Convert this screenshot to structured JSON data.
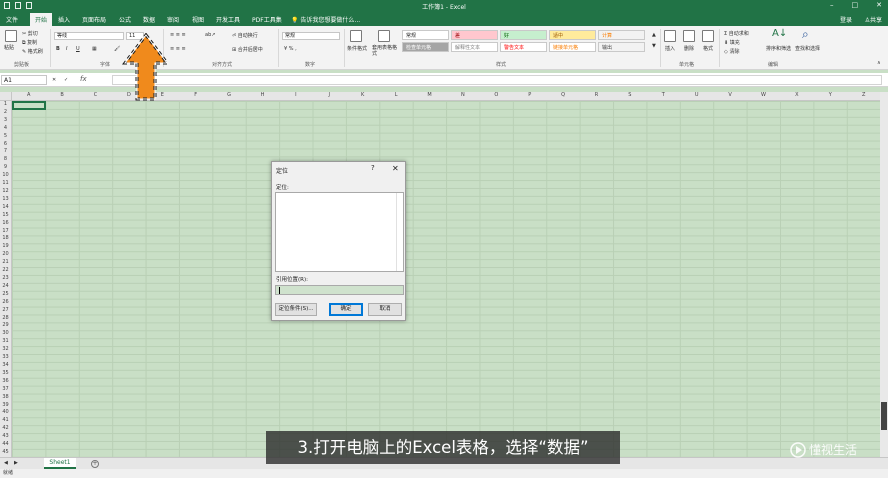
{
  "window": {
    "title": "工作簿1 - Excel"
  },
  "ribbon": {
    "tabs": [
      "文件",
      "开始",
      "插入",
      "页面布局",
      "公式",
      "数据",
      "审阅",
      "视图",
      "开发工具",
      "PDF工具集"
    ],
    "active_tab": "开始",
    "tell_me": "告诉我您想要做什么...",
    "login": "登录",
    "share": "共享",
    "clipboard": {
      "paste": "粘贴",
      "cut": "剪切",
      "copy": "复制",
      "format_painter": "格式刷",
      "group": "剪贴板"
    },
    "font": {
      "name": "等线",
      "size": "11",
      "group": "字体"
    },
    "alignment": {
      "wrap_text": "自动换行",
      "merge_center": "合并后居中",
      "group": "对齐方式"
    },
    "number": {
      "format": "常规",
      "group": "数字"
    },
    "styles": {
      "conditional_format": "条件格式",
      "table_format": "套用表格格式",
      "cells": [
        {
          "label": "常规",
          "bg": "#ffffff",
          "fg": "#222222"
        },
        {
          "label": "差",
          "bg": "#ffc7ce",
          "fg": "#9c0006"
        },
        {
          "label": "好",
          "bg": "#c6efce",
          "fg": "#006100"
        },
        {
          "label": "适中",
          "bg": "#ffeb9c",
          "fg": "#9c5700"
        },
        {
          "label": "计算",
          "bg": "#f2f2f2",
          "fg": "#fa7d00"
        },
        {
          "label": "检查单元格",
          "bg": "#a5a5a5",
          "fg": "#ffffff"
        },
        {
          "label": "解释性文本",
          "bg": "#ffffff",
          "fg": "#7f7f7f"
        },
        {
          "label": "警告文本",
          "bg": "#ffffff",
          "fg": "#ff0000"
        },
        {
          "label": "链接单元格",
          "bg": "#ffffff",
          "fg": "#fa7d00"
        },
        {
          "label": "输出",
          "bg": "#f2f2f2",
          "fg": "#3f3f3f"
        }
      ],
      "group": "样式"
    },
    "cells": {
      "insert": "插入",
      "delete": "删除",
      "format": "格式",
      "group": "单元格"
    },
    "editing": {
      "autosum": "自动求和",
      "fill": "填充",
      "clear": "清除",
      "sort_filter": "排序和筛选",
      "find_select": "查找和选择",
      "group": "编辑"
    }
  },
  "formula_bar": {
    "name_box": "A1",
    "fx": "fx"
  },
  "grid": {
    "columns": [
      "A",
      "B",
      "C",
      "D",
      "E",
      "F",
      "G",
      "H",
      "I",
      "J",
      "K",
      "L",
      "M",
      "N",
      "O",
      "P",
      "Q",
      "R",
      "S",
      "T",
      "U",
      "V",
      "W",
      "X",
      "Y",
      "Z"
    ],
    "rows": [
      "1",
      "2",
      "3",
      "4",
      "5",
      "6",
      "7",
      "8",
      "9",
      "10",
      "11",
      "12",
      "13",
      "14",
      "15",
      "16",
      "17",
      "18",
      "19",
      "20",
      "21",
      "22",
      "23",
      "24",
      "25",
      "26",
      "27",
      "28",
      "29",
      "30",
      "31",
      "32",
      "33",
      "34",
      "35",
      "36",
      "37",
      "38",
      "39",
      "40",
      "41",
      "42",
      "43",
      "44",
      "45"
    ]
  },
  "sheets": [
    "Sheet1"
  ],
  "status": "就绪",
  "dialog": {
    "title": "定位",
    "help": "?",
    "close": "✕",
    "goto_label": "定位:",
    "reference_label": "引用位置(R):",
    "special_button": "定位条件(S)...",
    "ok_button": "确定",
    "cancel_button": "取消"
  },
  "caption": "3.打开电脑上的Excel表格，选择“数据”",
  "watermark": "懂视生活",
  "colors": {
    "accent": "#217346",
    "grid_bg": "#c9dfc6",
    "arrow": "#f08a1c"
  }
}
